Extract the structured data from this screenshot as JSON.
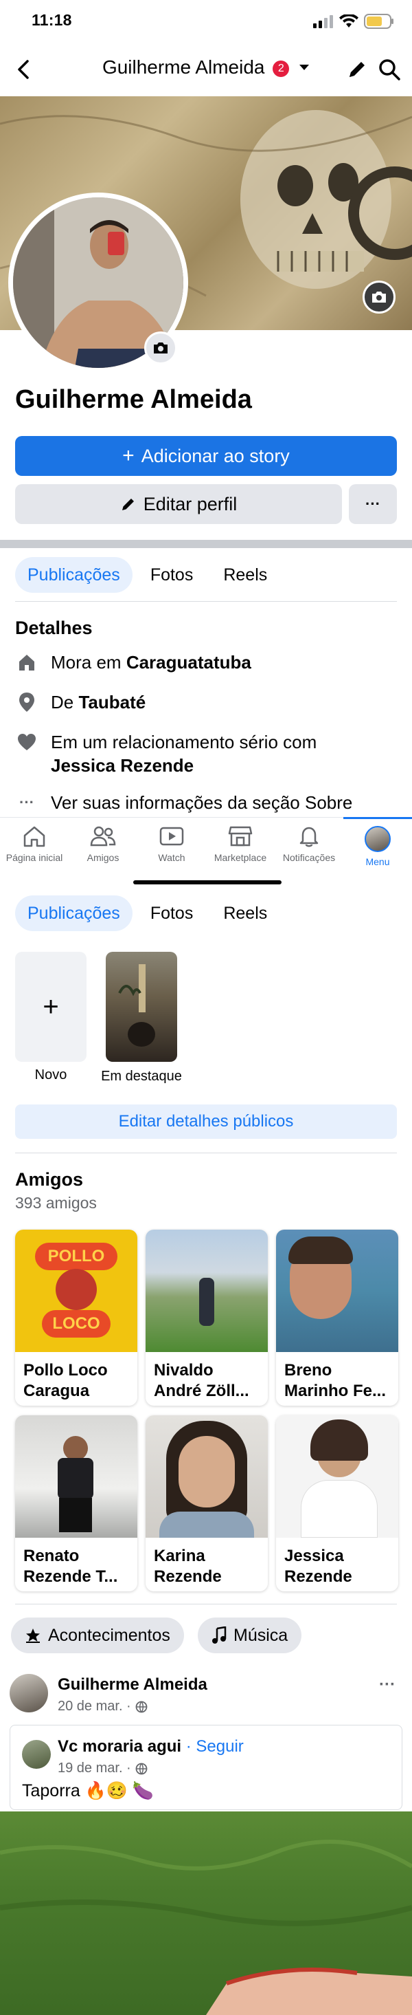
{
  "status_bar": {
    "time": "11:18"
  },
  "header": {
    "title": "Guilherme Almeida",
    "badge": "2"
  },
  "profile": {
    "name": "Guilherme Almeida"
  },
  "actions": {
    "add_story": "Adicionar ao story",
    "edit_profile": "Editar perfil",
    "more": "···"
  },
  "tabs": [
    "Publicações",
    "Fotos",
    "Reels"
  ],
  "details": {
    "title": "Detalhes",
    "lives_prefix": "Mora em ",
    "lives_city": "Caraguatatuba",
    "from_prefix": "De ",
    "from_city": "Taubaté",
    "relationship_prefix": "Em um relacionamento sério com",
    "relationship_name": "Jessica Rezende",
    "about_link": "Ver suas informações da seção Sobre"
  },
  "bottom_nav": [
    {
      "label": "Página inicial",
      "icon": "home-icon"
    },
    {
      "label": "Amigos",
      "icon": "friends-icon"
    },
    {
      "label": "Watch",
      "icon": "watch-icon"
    },
    {
      "label": "Marketplace",
      "icon": "marketplace-icon"
    },
    {
      "label": "Notificações",
      "icon": "bell-icon"
    },
    {
      "label": "Menu",
      "icon": "avatar"
    }
  ],
  "highlights": {
    "new_label": "Novo",
    "featured_label": "Em destaque",
    "edit_public": "Editar detalhes públicos"
  },
  "friends": {
    "title": "Amigos",
    "count": "393 amigos",
    "list": [
      {
        "name": "Pollo Loco Caragua"
      },
      {
        "name": "Nivaldo André Zöll..."
      },
      {
        "name": "Breno Marinho Fe..."
      },
      {
        "name": "Renato Rezende T..."
      },
      {
        "name": "Karina Rezende"
      },
      {
        "name": "Jessica Rezende"
      }
    ],
    "logo_text_top": "POLLO",
    "logo_text_bottom": "LOCO"
  },
  "chips": {
    "events": "Acontecimentos",
    "music": "Música"
  },
  "post": {
    "author": "Guilherme Almeida",
    "date": "20 de mar. ·",
    "shared_author": "Vc moraria agui",
    "follow": "· Seguir",
    "shared_date": "19 de mar. ·",
    "text": "Taporra 🔥🥴 🍆"
  },
  "colors": {
    "accent": "#1877f2",
    "primary_button": "#1b74e4",
    "badge": "#e41e3f"
  }
}
